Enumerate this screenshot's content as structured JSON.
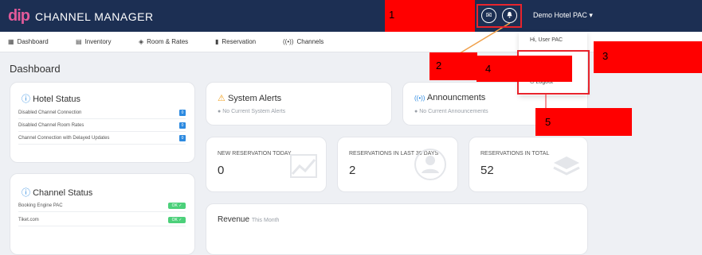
{
  "app": {
    "logo_text": "dip",
    "brand_text": "CHANNEL MANAGER"
  },
  "header": {
    "mail_icon_glyph": "✉",
    "bell_icon_glyph": "🔔",
    "user_menu_label": "Demo Hotel PAC ▾"
  },
  "nav": {
    "items": [
      {
        "icon": "dashboard-icon",
        "label": "Dashboard"
      },
      {
        "icon": "inventory-icon",
        "label": "Inventory"
      },
      {
        "icon": "room-rates-icon",
        "label": "Room & Rates"
      },
      {
        "icon": "reservation-icon",
        "label": "Reservation"
      },
      {
        "icon": "channels-icon",
        "label": "Channels"
      }
    ]
  },
  "dropdown": {
    "greeting": "Hi, User PAC",
    "logout_label": "Logout"
  },
  "page": {
    "title": "Dashboard"
  },
  "hotel_status": {
    "title": "Hotel Status",
    "rows": [
      {
        "label": "Disabled Channel Connection",
        "count": "0"
      },
      {
        "label": "Disabled Channel Room Rates",
        "count": "0"
      },
      {
        "label": "Channel Connection with Delayed Updates",
        "count": "0"
      }
    ]
  },
  "channel_status": {
    "title": "Channel Status",
    "rows": [
      {
        "label": "Booking Engine PAC",
        "status": "OK ✓"
      },
      {
        "label": "Tiket.com",
        "status": "OK ✓"
      }
    ]
  },
  "system_alerts": {
    "title": "System Alerts",
    "subtitle": "No Current System Alerts"
  },
  "announcements": {
    "title": "Announcments",
    "subtitle": "No Current Announcements"
  },
  "stats": [
    {
      "label": "NEW RESERVATION TODAY",
      "value": "0"
    },
    {
      "label": "RESERVATIONS IN LAST 30 DAYS",
      "value": "2"
    },
    {
      "label": "RESERVATIONS IN TOTAL",
      "value": "52"
    }
  ],
  "revenue": {
    "title": "Revenue",
    "period": "This Month"
  },
  "annotations": [
    {
      "number": "1"
    },
    {
      "number": "2"
    },
    {
      "number": "3"
    },
    {
      "number": "4"
    },
    {
      "number": "5"
    }
  ],
  "colors": {
    "topbar": "#1c2f53",
    "accent_blue": "#2d8ae0",
    "ok_green": "#4cd07a",
    "annotation_red": "#ff0000",
    "logo_pink": "#e25a9a"
  }
}
